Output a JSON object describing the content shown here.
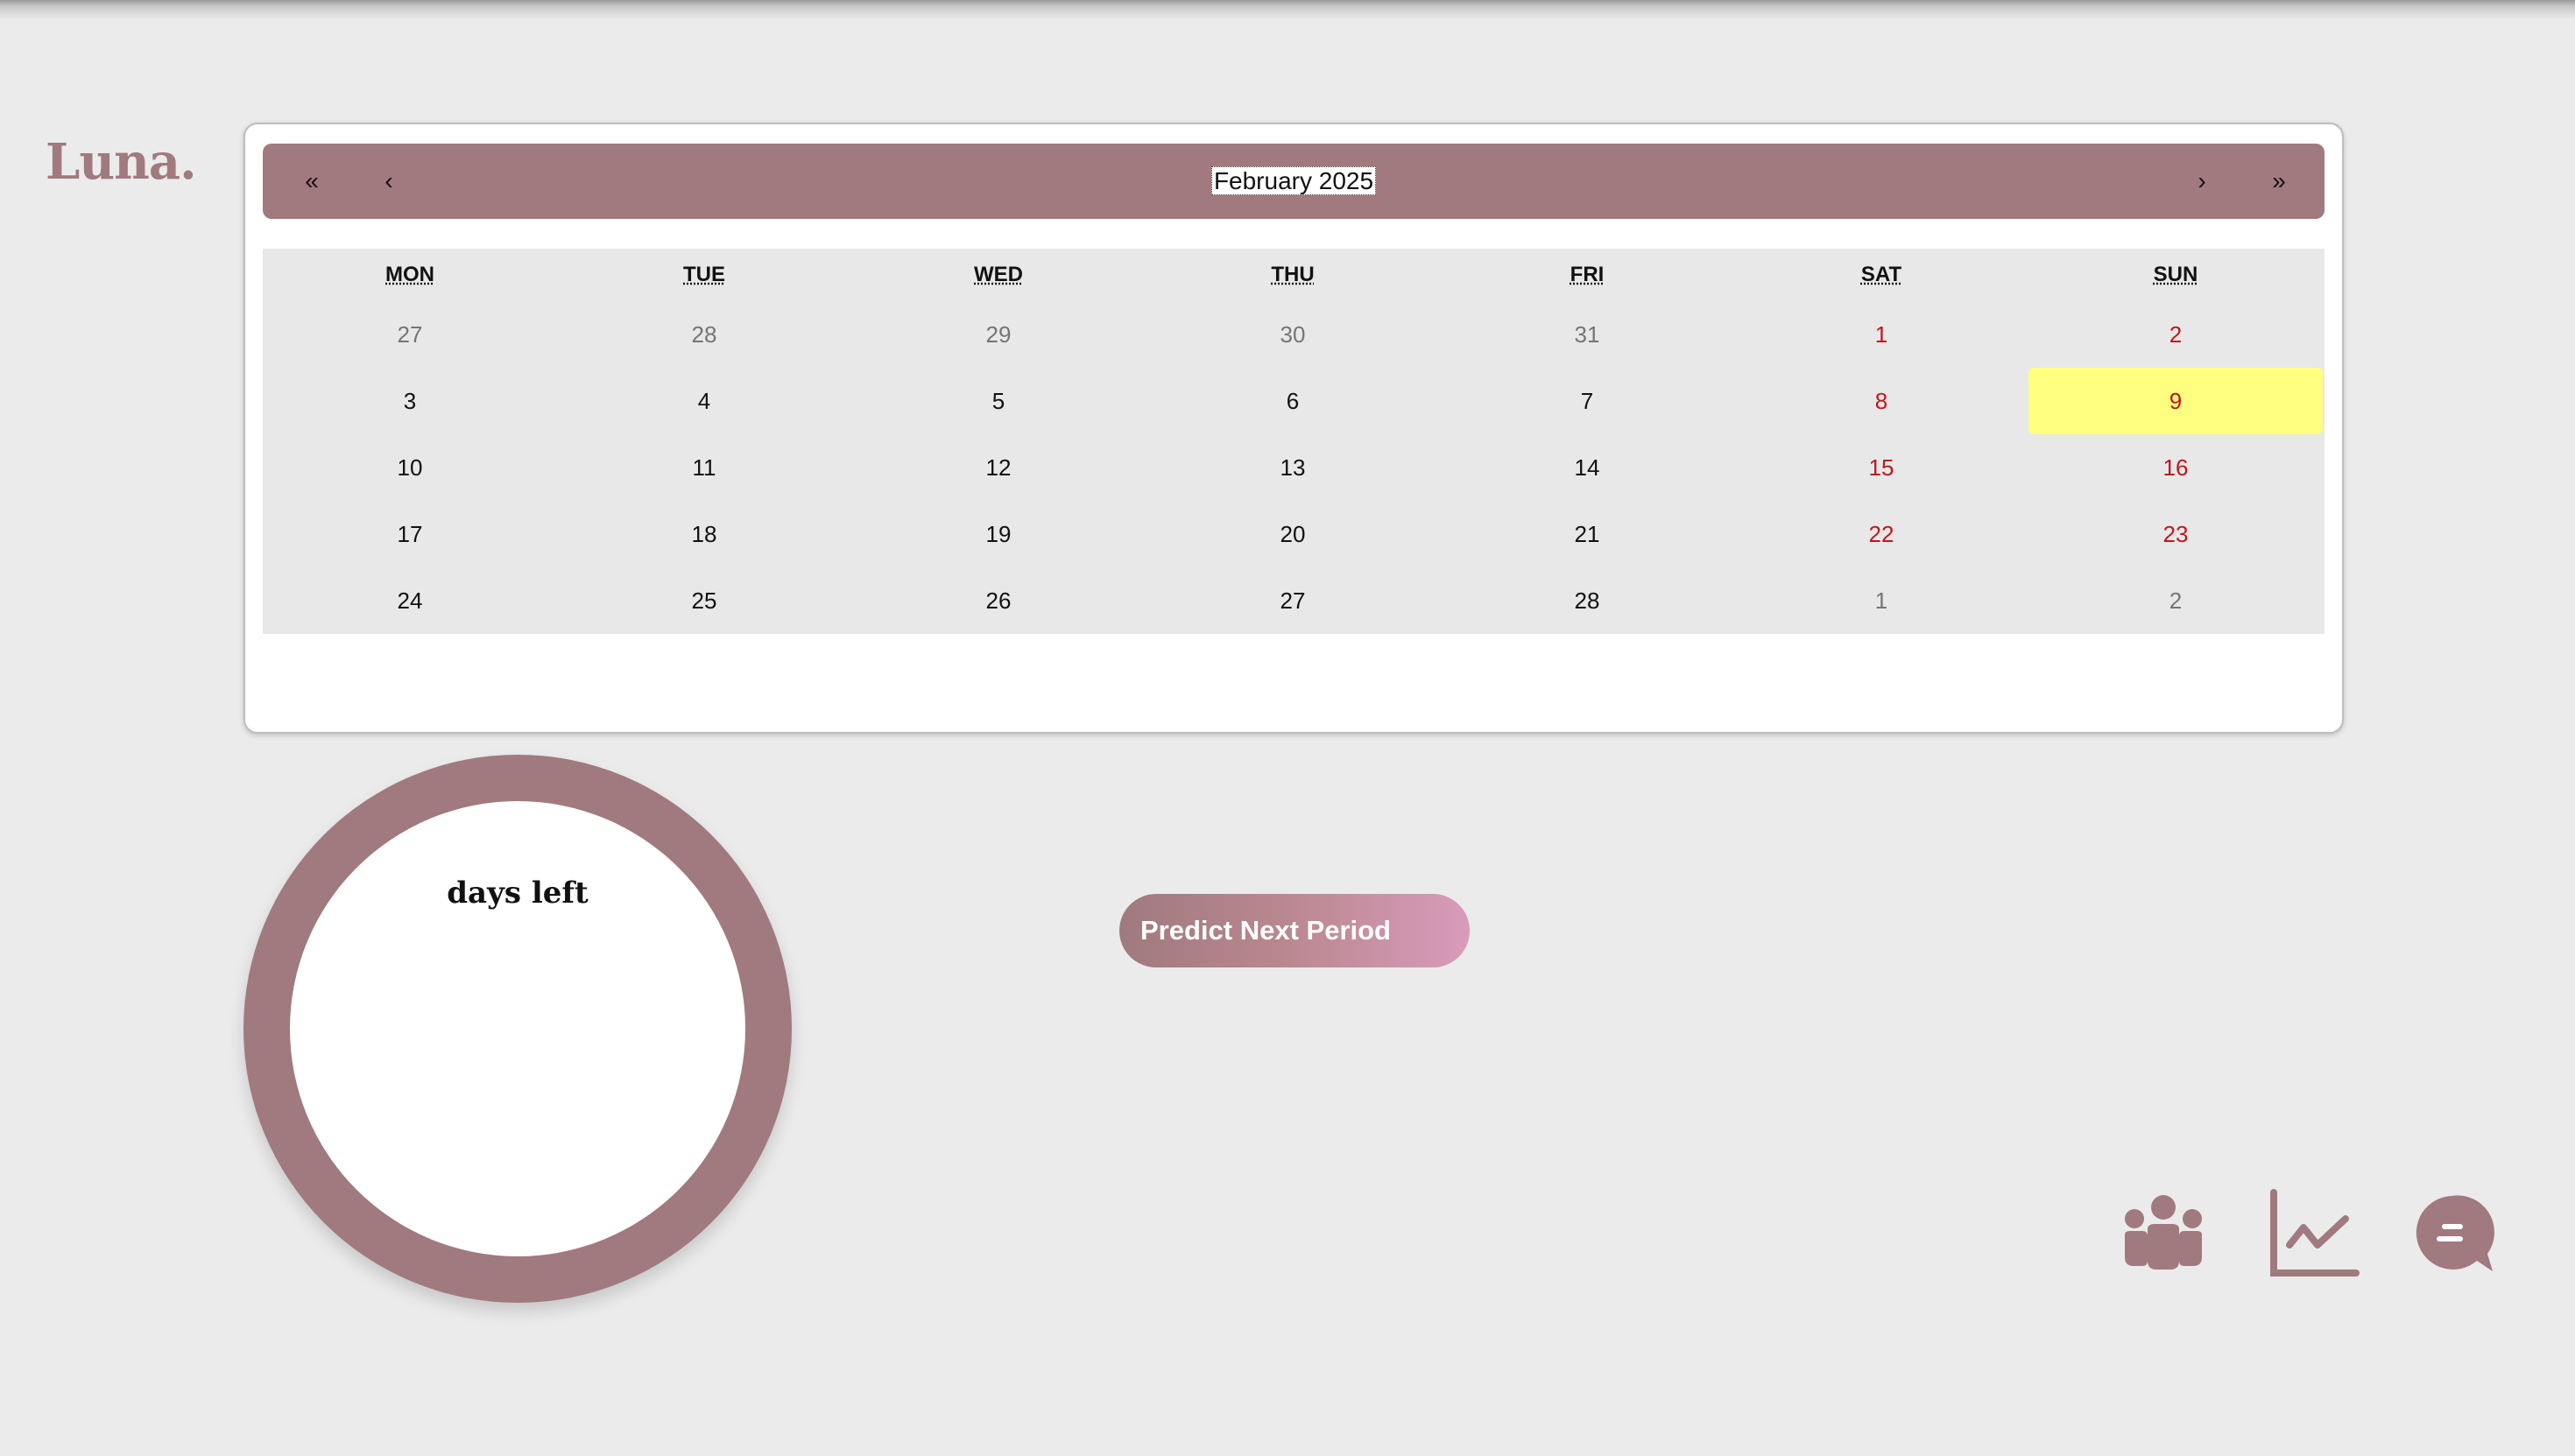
{
  "app": {
    "logo": "Luna."
  },
  "calendar": {
    "month_label": "February 2025",
    "nav": {
      "prev_year": "«",
      "prev_month": "‹",
      "next_month": "›",
      "next_year": "»"
    },
    "weekdays": [
      "MON",
      "TUE",
      "WED",
      "THU",
      "FRI",
      "SAT",
      "SUN"
    ],
    "weeks": [
      [
        "27",
        "28",
        "29",
        "30",
        "31",
        "1",
        "2"
      ],
      [
        "3",
        "4",
        "5",
        "6",
        "7",
        "8",
        "9"
      ],
      [
        "10",
        "11",
        "12",
        "13",
        "14",
        "15",
        "16"
      ],
      [
        "17",
        "18",
        "19",
        "20",
        "21",
        "22",
        "23"
      ],
      [
        "24",
        "25",
        "26",
        "27",
        "28",
        "1",
        "2"
      ]
    ],
    "selected_day": "9"
  },
  "countdown": {
    "label": "days left"
  },
  "actions": {
    "predict_label": "Predict Next Period"
  },
  "toolbar": {
    "icons": [
      "community-icon",
      "chart-icon",
      "chat-icon"
    ]
  },
  "colors": {
    "accent": "#a07a7e",
    "weekend": "#c0161d",
    "highlight": "#ffff7f",
    "background": "#ebebeb"
  }
}
